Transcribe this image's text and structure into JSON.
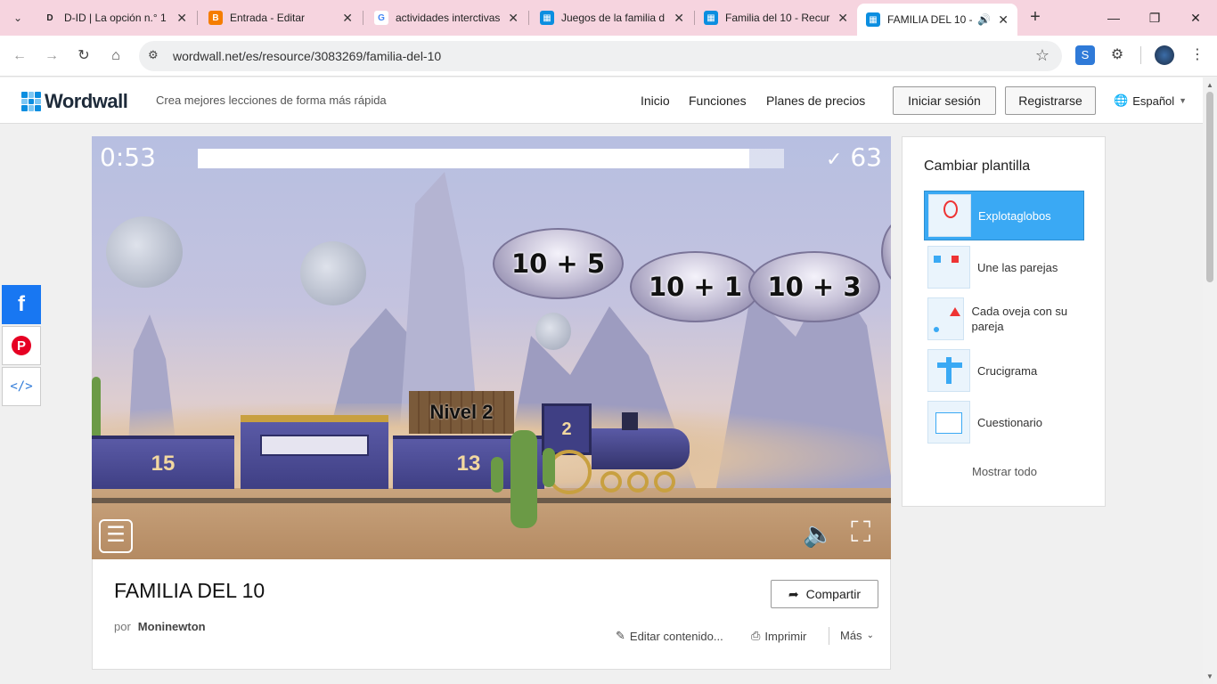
{
  "browser": {
    "tabs": [
      {
        "title": "D-ID | La opción n.° 1",
        "favicon": "did-icon",
        "color": "#333333"
      },
      {
        "title": "Entrada - Editar",
        "favicon": "blogger-icon",
        "color": "#f57d00"
      },
      {
        "title": "actividades interctivas",
        "favicon": "google-icon",
        "color": "#4285f4"
      },
      {
        "title": "Juegos de la familia d",
        "favicon": "wordwall-icon",
        "color": "#0b8ee0"
      },
      {
        "title": "Familia del 10 - Recur",
        "favicon": "wordwall-icon",
        "color": "#0b8ee0"
      },
      {
        "title": "FAMILIA DEL 10 -",
        "favicon": "wordwall-icon",
        "color": "#0b8ee0",
        "active": true
      }
    ],
    "url": "wordwall.net/es/resource/3083269/familia-del-10"
  },
  "header": {
    "logo_text": "Wordwall",
    "tagline": "Crea mejores lecciones de forma más rápida",
    "nav": [
      "Inicio",
      "Funciones",
      "Planes de precios"
    ],
    "login": "Iniciar sesión",
    "register": "Registrarse",
    "language": "Español"
  },
  "game": {
    "timer": "0:53",
    "score": "63",
    "progress": 0.94,
    "blimps": [
      "10 + 5",
      "10 + 1",
      "10 + 3"
    ],
    "level_sign": "Nivel 2",
    "cars": [
      "15",
      "13"
    ],
    "engine_number": "2"
  },
  "activity": {
    "title": "FAMILIA DEL 10",
    "by_label": "por",
    "author": "Moninewton",
    "share": "Compartir",
    "edit": "Editar contenido...",
    "print": "Imprimir",
    "more": "Más"
  },
  "templates": {
    "heading": "Cambiar plantilla",
    "items": [
      "Explotaglobos",
      "Une las parejas",
      "Cada oveja con su pareja",
      "Crucigrama",
      "Cuestionario"
    ],
    "show_all": "Mostrar todo"
  },
  "colors": {
    "accent": "#3aa9f4",
    "brand": "#0b8ee0",
    "facebook": "#1877f2",
    "pinterest": "#e60023"
  }
}
